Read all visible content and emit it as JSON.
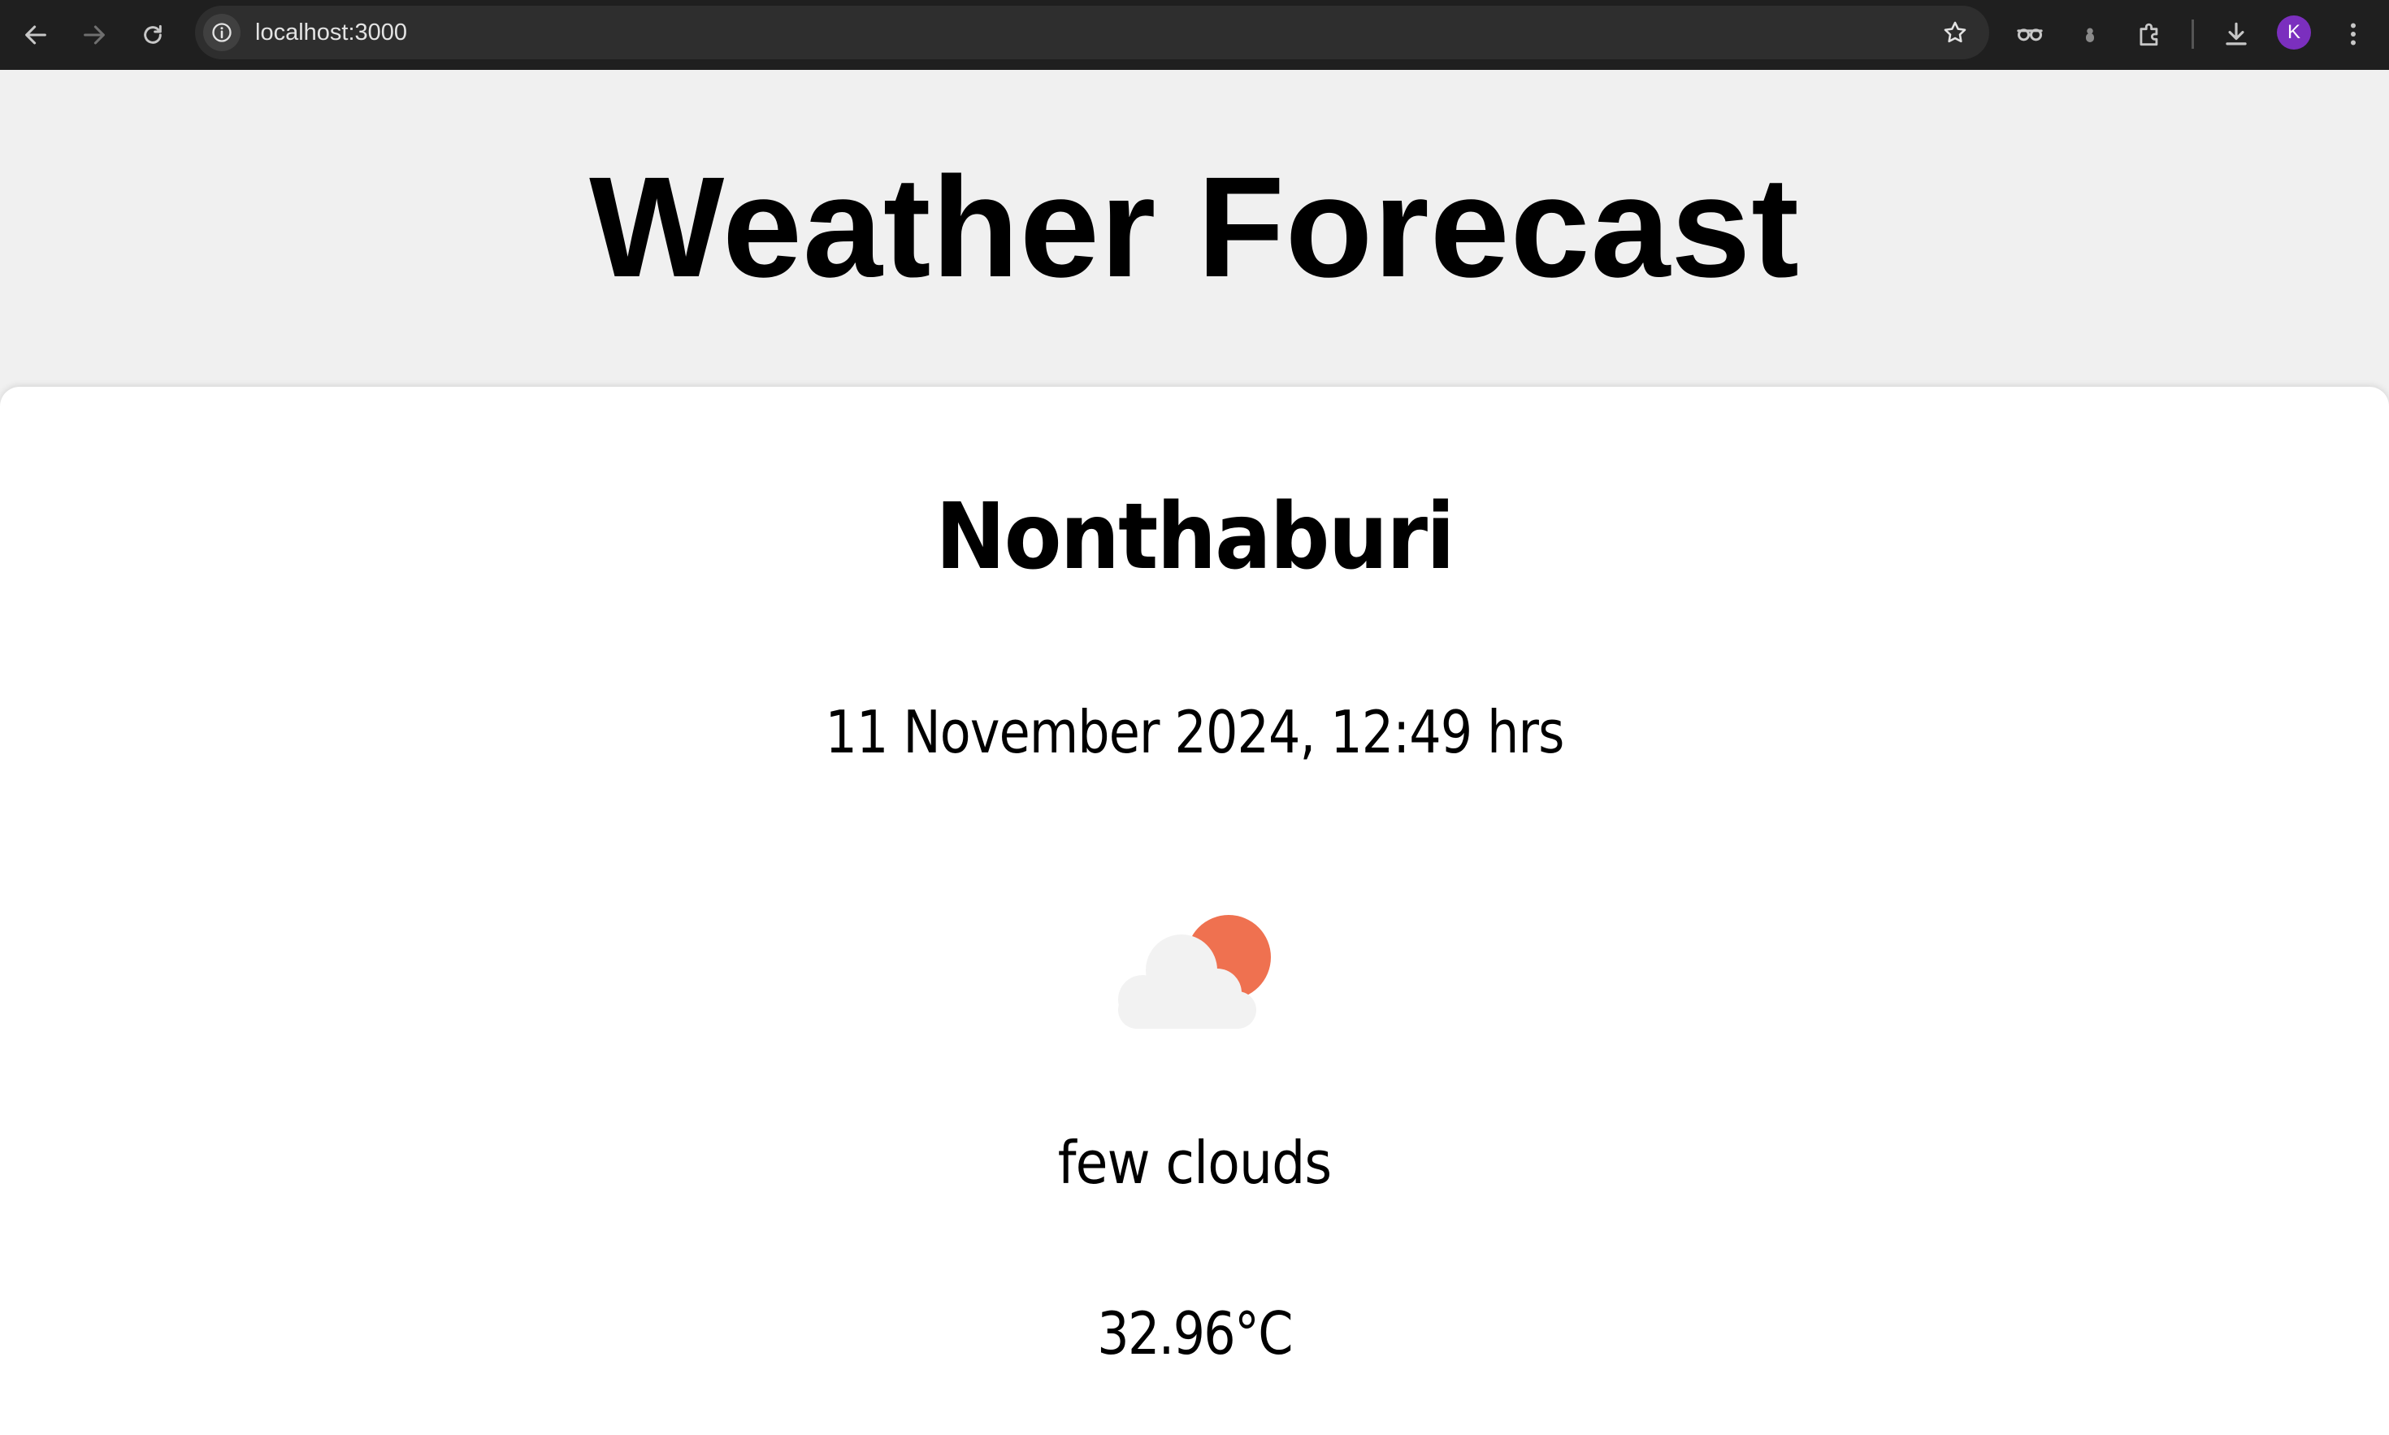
{
  "browser": {
    "url": "localhost:3000",
    "profile_initial": "K",
    "icons": {
      "back": "arrow-left-icon",
      "forward": "arrow-right-icon",
      "reload": "reload-icon",
      "site_info": "info-icon",
      "bookmark": "star-icon",
      "extension_a": "glasses-icon",
      "extension_b": "puzzle-icon",
      "downloads": "download-icon",
      "menu": "kebab-menu-icon"
    }
  },
  "page": {
    "title": "Weather Forecast"
  },
  "weather": {
    "city": "Nonthaburi",
    "datetime": "11 November 2024, 12:49 hrs",
    "icon": "few-clouds-icon",
    "description": "few clouds",
    "temperature": "32.96°C"
  },
  "colors": {
    "page_background": "#f0f0f0",
    "card_background": "#ffffff",
    "sun": "#ef7150",
    "cloud": "#f2f2f2",
    "avatar": "#7b2fbe"
  }
}
